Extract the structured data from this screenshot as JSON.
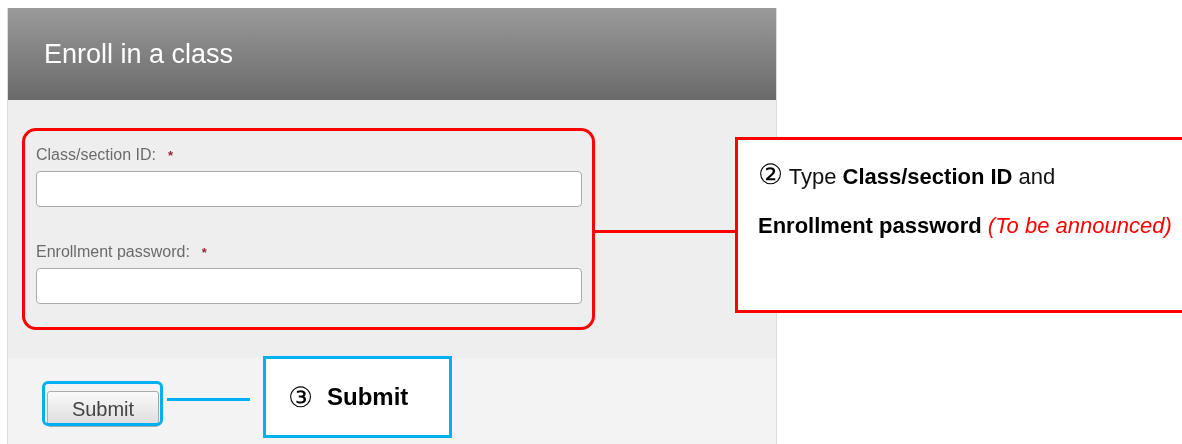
{
  "dialog": {
    "title": "Enroll in a class",
    "fields": [
      {
        "label": "Class/section ID:",
        "required_mark": "*"
      },
      {
        "label": "Enrollment password:",
        "required_mark": "*"
      }
    ],
    "submit_button": "Submit"
  },
  "annotations": [
    {
      "number": "②",
      "text": "Type **Class/section ID** and **Enrollment password** *(To be announced)*",
      "color": "#ff0000"
    },
    {
      "number": "③",
      "text": "Submit",
      "color": "#00b0f0"
    }
  ]
}
